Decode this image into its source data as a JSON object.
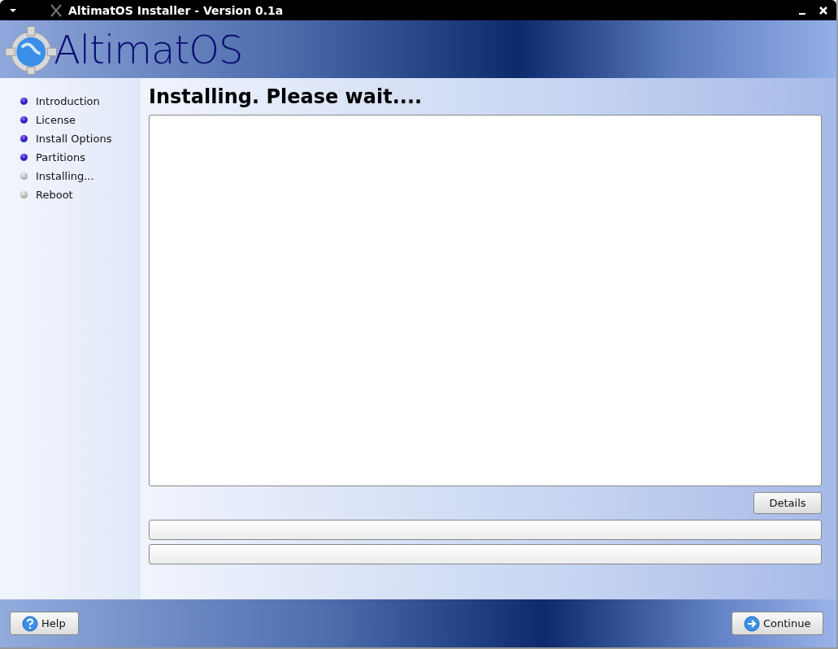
{
  "window": {
    "title": "AltimatOS Installer - Version 0.1a"
  },
  "header": {
    "logo_text": "AltimatOS"
  },
  "sidebar": {
    "steps": [
      {
        "label": "Introduction",
        "completed": true
      },
      {
        "label": "License",
        "completed": true
      },
      {
        "label": "Install Options",
        "completed": true
      },
      {
        "label": "Partitions",
        "completed": true
      },
      {
        "label": "Installing...",
        "completed": false
      },
      {
        "label": "Reboot",
        "completed": false
      }
    ]
  },
  "content": {
    "heading": "Installing. Please wait....",
    "details_button": "Details",
    "progress_bars": [
      {
        "level": 0
      },
      {
        "level": 0
      }
    ]
  },
  "footer": {
    "help_button": "Help",
    "continue_button": "Continue"
  }
}
